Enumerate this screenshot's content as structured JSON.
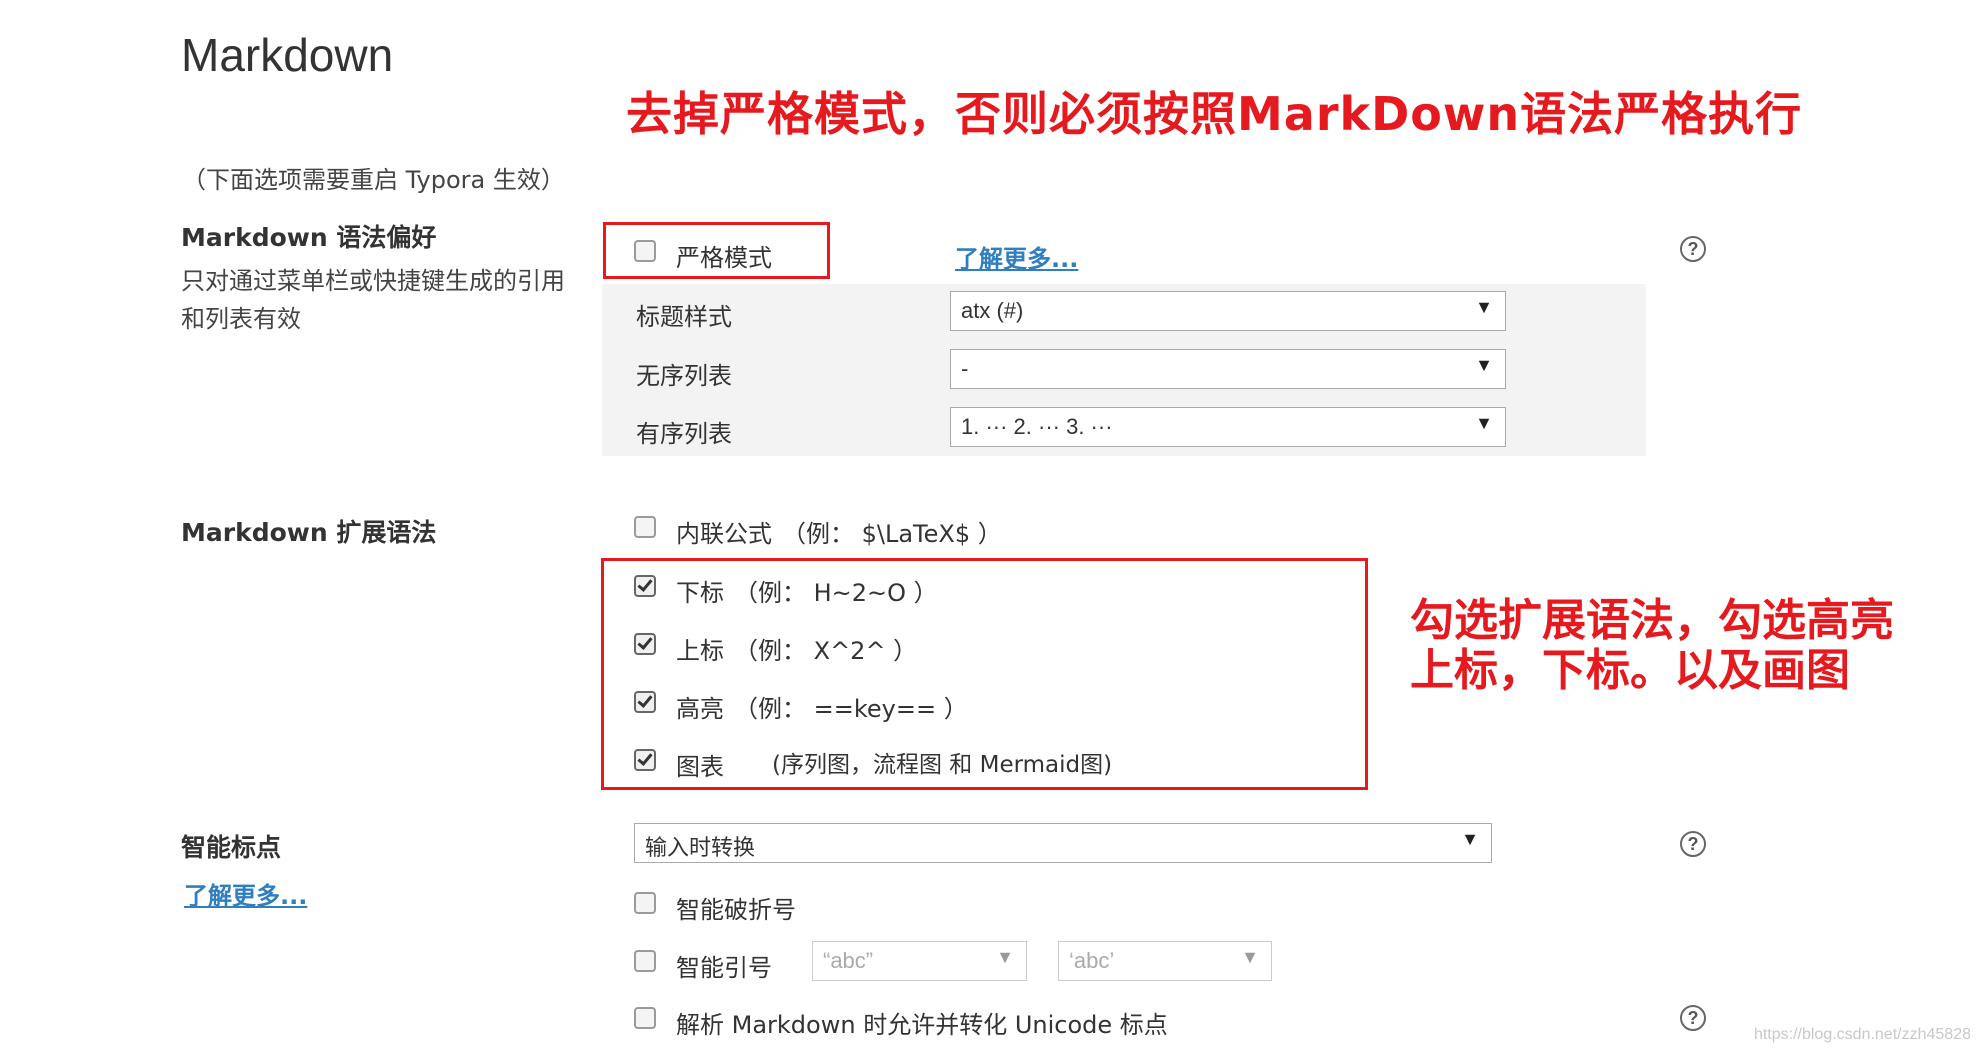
{
  "page": {
    "title": "Markdown",
    "restart_note": "（下面选项需要重启 Typora 生效）"
  },
  "syntax_pref": {
    "title": "Markdown 语法偏好",
    "description": "只对通过菜单栏或快捷键生成的引用和列表有效",
    "strict_mode_label": "严格模式",
    "strict_mode_checked": false,
    "learn_more": "了解更多...",
    "heading_style_label": "标题样式",
    "heading_style_value": "atx (#)",
    "unordered_list_label": "无序列表",
    "unordered_list_value": "-",
    "ordered_list_label": "有序列表",
    "ordered_list_value": "1. ··· 2. ··· 3. ···"
  },
  "extended_syntax": {
    "title": "Markdown 扩展语法",
    "items": [
      {
        "label": "内联公式",
        "example": "（例：  $\\LaTeX$ ）",
        "checked": false
      },
      {
        "label": "下标",
        "example": "（例：  H~2~O ）",
        "checked": true
      },
      {
        "label": "上标",
        "example": "（例：  X^2^ ）",
        "checked": true
      },
      {
        "label": "高亮",
        "example": "（例：  ==key== ）",
        "checked": true
      },
      {
        "label": "图表",
        "example": "(序列图，流程图 和 Mermaid图)",
        "checked": true
      }
    ]
  },
  "smart_punct": {
    "title": "智能标点",
    "learn_more": "了解更多...",
    "mode_value": "输入时转换",
    "smart_dash_label": "智能破折号",
    "smart_dash_checked": false,
    "smart_quotes_label": "智能引号",
    "smart_quotes_checked": false,
    "double_quote_value": "“abc”",
    "single_quote_value": "‘abc’",
    "unicode_label": "解析 Markdown 时允许并转化 Unicode 标点",
    "unicode_checked": false
  },
  "annotations": {
    "top": "去掉严格模式，否则必须按照MarkDown语法严格执行",
    "right_line1": "勾选扩展语法，勾选高亮",
    "right_line2": "上标，下标。以及画图"
  },
  "icons": {
    "help": "?",
    "dropdown": "▼",
    "check": "checkmark-icon"
  },
  "colors": {
    "annotation_red": "#e5191e",
    "link_blue": "#2f7fc0"
  },
  "watermark": "https://blog.csdn.net/zzh45828"
}
